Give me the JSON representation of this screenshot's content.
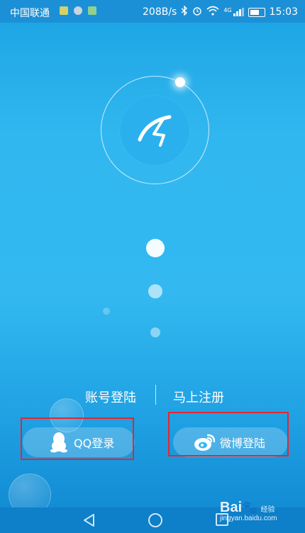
{
  "status_bar": {
    "carrier": "中国联通",
    "network_speed": "208B/s",
    "network_type": "4G",
    "time": "15:03"
  },
  "auth": {
    "account_login": "账号登陆",
    "register": "马上注册"
  },
  "social_login": {
    "qq_label": "QQ登录",
    "weibo_label": "微博登陆"
  },
  "watermark": {
    "brand": "Bai",
    "brand_suffix": "经验",
    "url": "jingyan.baidu.com"
  },
  "colors": {
    "background": "#33b9f0",
    "status_bar": "#1c90d6",
    "highlight": "#e4262f",
    "nav_bar": "#0e7fc9"
  }
}
